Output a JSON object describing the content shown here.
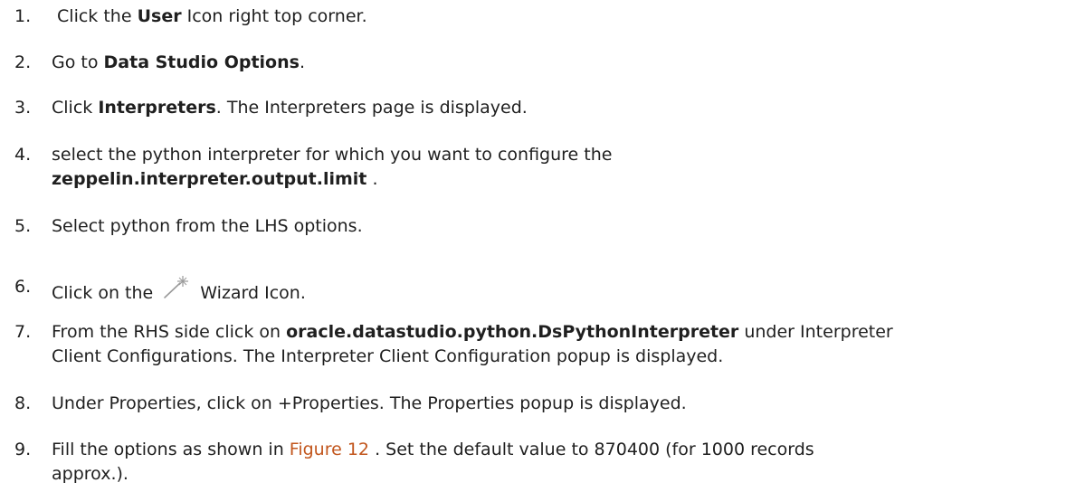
{
  "steps": [
    {
      "num": "1.",
      "pre": " Click the ",
      "bold": "User",
      "post": " Icon right top corner."
    },
    {
      "num": "2.",
      "pre": "Go to ",
      "bold": "Data Studio Options",
      "post": "."
    },
    {
      "num": "3.",
      "pre": "Click ",
      "bold": "Interpreters",
      "post": ". The Interpreters page is displayed."
    },
    {
      "num": "4.",
      "pre": "select the python interpreter for which you want to configure the",
      "bold": "zeppelin.interpreter.output.limit",
      "post": " ."
    },
    {
      "num": "5.",
      "text": "Select python from the LHS options."
    },
    {
      "num": "6.",
      "pre": "Click on the ",
      "post": " Wizard Icon.",
      "icon": "magic-wand-icon"
    },
    {
      "num": "7.",
      "pre": "From the RHS side click on ",
      "bold": "oracle.datastudio.python.DsPythonInterpreter",
      "post": " under Interpreter",
      "line2": "Client Configurations. The Interpreter Client Configuration popup is displayed."
    },
    {
      "num": "8.",
      "text": "Under Properties, click on +Properties. The Properties popup is displayed."
    },
    {
      "num": "9.",
      "pre": "Fill the options as shown in ",
      "link": "Figure 12",
      "post": " . Set the default value to 870400 (for 1000 records",
      "line2": "approx.)."
    }
  ],
  "colors": {
    "text": "#1f1f1f",
    "link": "#c2561d",
    "icon": "#9a9a9a"
  }
}
